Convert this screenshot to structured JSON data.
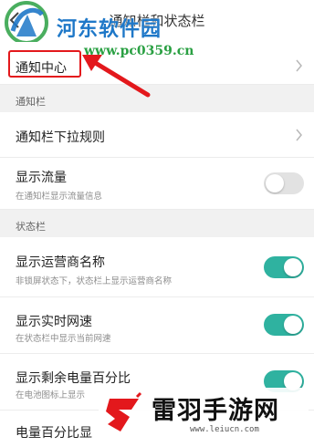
{
  "header": {
    "title": "通知栏和状态栏"
  },
  "watermark_top": {
    "brand": "河东软件园",
    "url": "www.pc0359.cn"
  },
  "notification_center": {
    "label": "通知中心"
  },
  "sections": {
    "notification_bar": "通知栏",
    "status_bar": "状态栏"
  },
  "items": {
    "pull_rules": {
      "label": "通知栏下拉规则"
    },
    "show_traffic": {
      "label": "显示流量",
      "sub": "在通知栏显示流量信息",
      "on": false
    },
    "show_carrier": {
      "label": "显示运营商名称",
      "sub": "非锁屏状态下，状态栏上显示运营商名称",
      "on": true
    },
    "show_speed": {
      "label": "显示实时网速",
      "sub": "在状态栏中显示当前网速",
      "on": true
    },
    "show_battery_pct": {
      "label": "显示剩余电量百分比",
      "sub": "在电池图标上显示",
      "on": true
    },
    "battery_pct_style": {
      "label": "电量百分比显"
    }
  },
  "watermark_bottom": {
    "brand": "雷羽手游网",
    "url": "www.leiucn.com"
  },
  "colors": {
    "toggle_on": "#2fb2a0",
    "toggle_off": "#e2e2e2",
    "highlight": "#e3181c",
    "section_bg": "#f1f1f1"
  }
}
